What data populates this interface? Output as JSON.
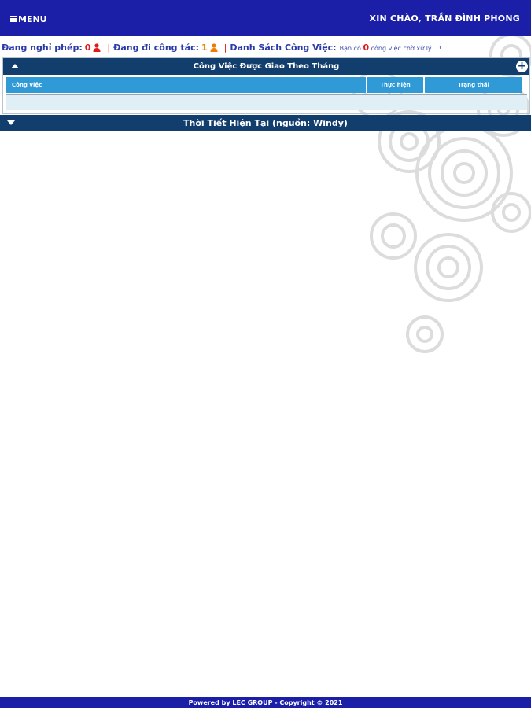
{
  "header": {
    "menu_label": "MENU",
    "greeting": "XIN CHÀO, TRẦN ĐÌNH PHONG"
  },
  "status": {
    "leave_label": "Đang nghỉ phép:",
    "leave_count": "0",
    "trip_label": "Đang đi công tác:",
    "trip_count": "1",
    "tasks_label": "Danh Sách Công Việc:",
    "tasks_prefix": "Bạn có",
    "tasks_count": "0",
    "tasks_suffix": "công việc chờ xử lý... !",
    "separator": "|"
  },
  "tasks_panel": {
    "title": "Công Việc Được Giao Theo Tháng",
    "columns": [
      "Công việc",
      "Thực hiện",
      "Trạng thái"
    ]
  },
  "weather_panel": {
    "title": "Thời Tiết Hiện Tại (nguồn: Windy)"
  },
  "footer": {
    "text": "Powered by LEC GROUP - Copyright © 2021"
  },
  "colors": {
    "header_bg": "#1b1fa8",
    "panel_head_bg": "#123e6e",
    "column_head_bg": "#2f9ad6",
    "count_red": "#e01a1a",
    "count_orange": "#f07d00"
  },
  "icons": {
    "menu": "hamburger-icon",
    "leave": "person-icon",
    "trip": "person-icon",
    "add": "plus-circle-icon",
    "collapse": "caret-up-icon",
    "expand": "caret-down-icon"
  }
}
